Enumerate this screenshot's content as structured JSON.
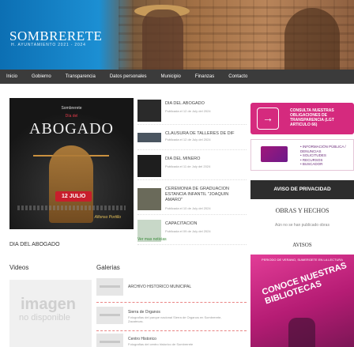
{
  "site": {
    "logo_text": "SOMBRERETE",
    "logo_sub": "H. AYUNTAMIENTO 2021 - 2024"
  },
  "nav": {
    "items": [
      "Inicio",
      "Gobierno",
      "Transparencia",
      "Datos personales",
      "Municipio",
      "Finanzas",
      "Contacto"
    ]
  },
  "hero": {
    "poster_logo": "Sombrerete",
    "poster_day": "Día del",
    "poster_title": "ABOGADO",
    "poster_date": "12 JULIO",
    "poster_signature": "Alfonso Portillo",
    "caption": "DIA DEL ABOGADO"
  },
  "news": {
    "items": [
      {
        "title": "DIA DEL ABOGADO",
        "meta": "Publicada el 12 de July del 2024"
      },
      {
        "title": "CLAUSURA DE TALLERES DE DIF",
        "meta": "Publicada el 12 de July del 2024"
      },
      {
        "title": "DIA DEL MINERO",
        "meta": "Publicada el 11 de July del 2024"
      },
      {
        "title": "CEREMONIA DE GRADUACION ESTANCIA INFANTIL \"JOAQUIN AMARO\"",
        "meta": "Publicada el 10 de July del 2024"
      },
      {
        "title": "CAPACITACION",
        "meta": "Publicada el 09 de July del 2024"
      }
    ],
    "more": "Ver mas noticias"
  },
  "right": {
    "consulta_text": "CONSULTA NUESTRAS OBLIGACIONES DE TRANSPARENCIA (LGT ARTICULO 66)",
    "pnt_items": [
      "• INFORMACIÓN PÚBLICA / DENUNCIAS",
      "• SOLICITUDES",
      "• RECURSOS",
      "• BUSCADOR"
    ],
    "aviso_privacidad": "AVISO DE PRIVACIDAD",
    "obras_heading": "OBRAS Y HECHOS",
    "obras_empty": "Aún no se han publicado obras",
    "avisos_heading": "AVISOS",
    "aviso_head": "PERIODO DE VERANO, SUMERGETE EN LA LECTURA",
    "aviso_big": "CONOCE NUESTRAS BIBLIOTECAS"
  },
  "media": {
    "videos_heading": "Videos",
    "galerias_heading": "Galerias",
    "video_placeholder_1": "imagen",
    "video_placeholder_2": "no disponible",
    "galleries": [
      {
        "title": "ARCHIVO HISTORICO MUNICIPAL",
        "desc": ""
      },
      {
        "title": "Sierra de Organos",
        "desc": "Fotografias del parque nacional Sierra de Organos en Sombrerete, Zacatecas."
      },
      {
        "title": "Centro Historico",
        "desc": "Fotografias del centro historico de Sombrerete"
      }
    ]
  }
}
